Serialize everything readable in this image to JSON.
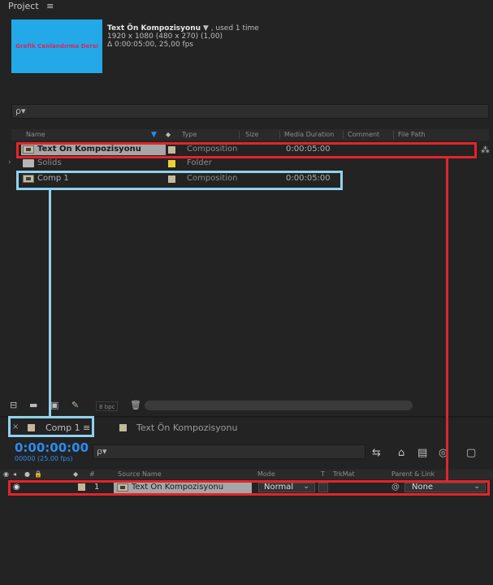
{
  "project": {
    "title": "Project",
    "menu_icon": "≡",
    "thumbnail_text": "Grafik Canlandırma Dersi",
    "selected_name": "Text Ön Kompozisyonu",
    "used_text": "▼ , used 1 time",
    "resolution": "1920 x 1080  (480 x 270) (1,00)",
    "duration_fps": "Δ 0:00:05:00, 25,00 fps",
    "search_icon": "ρ▾",
    "columns": {
      "name": "Name",
      "type": "Type",
      "size": "Size",
      "media_duration": "Media Duration",
      "comment": "Comment",
      "file_path": "File Path"
    },
    "items": [
      {
        "name": "Text Ön Kompozisyonu",
        "type": "Composition",
        "duration": "0:00:05:00",
        "label_color": "#c3b89b"
      },
      {
        "name": "Solids",
        "type": "Folder",
        "duration": "",
        "label_color": "#e6d430"
      },
      {
        "name": "Comp 1",
        "type": "Composition",
        "duration": "0:00:05:00",
        "label_color": "#c3b89b"
      }
    ],
    "bpc": "8 bpc"
  },
  "timeline": {
    "tabs": [
      {
        "name": "Comp 1",
        "active": true
      },
      {
        "name": "Text Ön Kompozisyonu",
        "active": false
      }
    ],
    "close_icon": "×",
    "menu_icon": "≡",
    "timecode": "0:00:00:00",
    "fps": "00000 (25.00 fps)",
    "search_icon": "ρ▾",
    "columns": {
      "source_name": "Source Name",
      "mode": "Mode",
      "t": "T",
      "trkmat": "TrkMat",
      "parent": "Parent & Link"
    },
    "layer": {
      "index": "1",
      "name": "Text Ön Kompozisyonu",
      "mode": "Normal",
      "parent": "None"
    }
  },
  "colors": {
    "highlight_red": "#e3242b",
    "highlight_blue": "#8fd2ee",
    "timecode_blue": "#2c8cf0",
    "thumbnail_bg": "#23a8e8"
  }
}
